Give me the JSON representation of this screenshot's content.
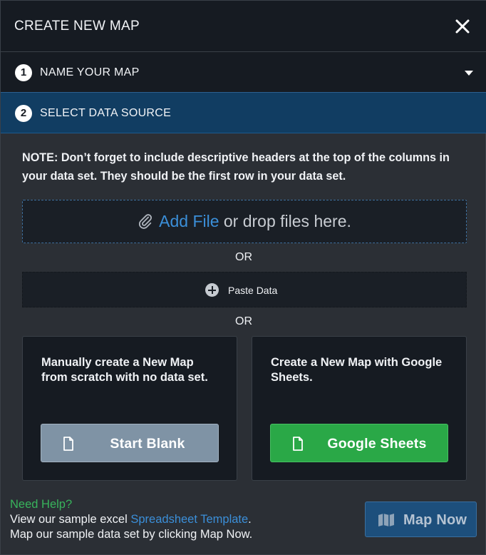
{
  "header": {
    "title": "CREATE NEW MAP",
    "close_icon": "close-icon"
  },
  "steps": [
    {
      "number": "1",
      "label": "NAME YOUR MAP",
      "expanded": false
    },
    {
      "number": "2",
      "label": "SELECT DATA SOURCE",
      "expanded": true
    }
  ],
  "data_source": {
    "note": "NOTE: Don’t forget to include descriptive headers at the top of the columns in your data set. They should be the first row in your data set.",
    "dropzone": {
      "add_file": "Add File",
      "drop_text": " or drop files here.",
      "icon": "paperclip-icon"
    },
    "or_1": "OR",
    "paste": {
      "label": "Paste Data",
      "icon": "plus-circle-icon"
    },
    "or_2": "OR",
    "cards": [
      {
        "description": "Manually create a New Map from scratch with no data set.",
        "button_label": "Start Blank",
        "button_color": "#7f93a5"
      },
      {
        "description": "Create a New Map with Google Sheets.",
        "button_label": "Google Sheets",
        "button_color": "#2aa847"
      }
    ]
  },
  "footer": {
    "need_help": "Need Help?",
    "line1_prefix": "View our sample excel ",
    "line1_link": "Spreadsheet Template",
    "line1_suffix": ".",
    "line2": "Map our sample data set by clicking Map Now.",
    "map_now_label": "Map Now"
  },
  "colors": {
    "accent_blue": "#3b8fd9",
    "active_step_bg": "#113d62",
    "help_green": "#38b45c"
  }
}
